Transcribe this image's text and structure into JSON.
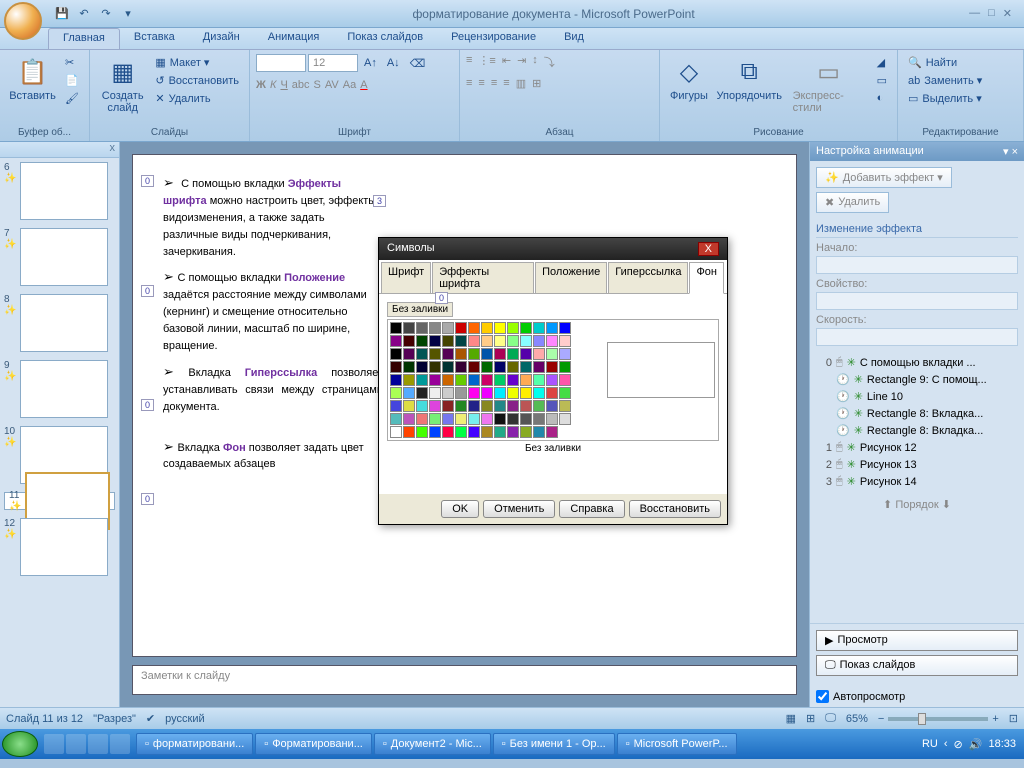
{
  "title": "форматирование документа - Microsoft PowerPoint",
  "qat": [
    "save",
    "undo",
    "redo"
  ],
  "tabs": [
    "Главная",
    "Вставка",
    "Дизайн",
    "Анимация",
    "Показ слайдов",
    "Рецензирование",
    "Вид"
  ],
  "ribbon": {
    "clipboard": {
      "label": "Буфер об...",
      "paste": "Вставить"
    },
    "slides": {
      "label": "Слайды",
      "new": "Создать\nслайд",
      "layout": "Макет ▾",
      "reset": "Восстановить",
      "delete": "Удалить"
    },
    "font": {
      "label": "Шрифт",
      "size": "12"
    },
    "para": {
      "label": "Абзац"
    },
    "draw": {
      "label": "Рисование",
      "shapes": "Фигуры",
      "arrange": "Упорядочить",
      "styles": "Экспресс-стили"
    },
    "edit": {
      "label": "Редактирование",
      "find": "Найти",
      "replace": "Заменить ▾",
      "select": "Выделить ▾"
    }
  },
  "thumbs": [
    6,
    7,
    8,
    9,
    10,
    11,
    12
  ],
  "active_thumb": 11,
  "slide": {
    "p1_pre": "С помощью вкладки ",
    "p1_b": "Эффекты шрифта",
    "p1_post": " можно настроить цвет, эффекты видоизменения, а также задать различные виды подчеркивания, зачеркивания.",
    "p2_pre": "С помощью вкладки ",
    "p2_b": "Положение",
    "p2_post": " задаётся расстояние между символами (кернинг) и смещение относительно базовой линии, масштаб по ширине, вращение.",
    "p3_pre": "Вкладка ",
    "p3_b": "Гиперссылка",
    "p3_post": " позволяет устанавливать связи между страницами документа.",
    "p4_pre": "Вкладка ",
    "p4_b": "Фон",
    "p4_post": " позволяет задать цвет создаваемых  абзацев",
    "tags": [
      "0",
      "0",
      "0",
      "0",
      "3",
      "0"
    ]
  },
  "notes": "Заметки к слайду",
  "dialog": {
    "title": "Символы",
    "tabs": [
      "Шрифт",
      "Эффекты шрифта",
      "Положение",
      "Гиперссылка",
      "Фон"
    ],
    "active_tab": 4,
    "nofill": "Без заливки",
    "nofill2": "Без заливки",
    "btns": {
      "ok": "OK",
      "cancel": "Отменить",
      "help": "Справка",
      "reset": "Восстановить"
    },
    "palette": [
      "#000",
      "#444",
      "#666",
      "#888",
      "#aaa",
      "#c00",
      "#f60",
      "#fc0",
      "#ff0",
      "#9f0",
      "#0c0",
      "#0cc",
      "#09f",
      "#00f",
      "#808",
      "#400",
      "#040",
      "#004",
      "#440",
      "#044",
      "#f88",
      "#fc8",
      "#ff8",
      "#8f8",
      "#8ff",
      "#88f",
      "#f8f",
      "#fcc",
      "#000",
      "#505",
      "#055",
      "#550",
      "#505",
      "#a50",
      "#5a0",
      "#05a",
      "#a05",
      "#0a5",
      "#50a",
      "#faa",
      "#afa",
      "#aaf",
      "#300",
      "#030",
      "#003",
      "#330",
      "#033",
      "#303",
      "#600",
      "#060",
      "#006",
      "#660",
      "#066",
      "#606",
      "#900",
      "#090",
      "#009",
      "#990",
      "#099",
      "#909",
      "#c60",
      "#6c0",
      "#06c",
      "#c06",
      "#0c6",
      "#60c",
      "#fa5",
      "#5fa",
      "#a5f",
      "#f5a",
      "#af5",
      "#5af",
      "#222",
      "#eee",
      "#ccc",
      "#999",
      "#f0e",
      "#e0f",
      "#0ef",
      "#ef0",
      "#fe0",
      "#0fe",
      "#d44",
      "#4d4",
      "#44d",
      "#dd4",
      "#4dd",
      "#d4d",
      "#822",
      "#282",
      "#228",
      "#882",
      "#288",
      "#828",
      "#b55",
      "#5b5",
      "#55b",
      "#bb5",
      "#5bb",
      "#b5b",
      "#e77",
      "#7e7",
      "#77e",
      "#ee7",
      "#7ee",
      "#e7e",
      "#111",
      "#333",
      "#555",
      "#777",
      "#bbb",
      "#ddd",
      "#fff",
      "#f40",
      "#4f0",
      "#04f",
      "#f04",
      "#0f4",
      "#40f",
      "#a82",
      "#2a8",
      "#82a",
      "#8a2",
      "#28a",
      "#a28"
    ]
  },
  "taskpane": {
    "title": "Настройка анимации",
    "add": "Добавить эффект ▾",
    "remove": "Удалить",
    "change": "Изменение эффекта",
    "start": "Начало:",
    "prop": "Свойство:",
    "speed": "Скорость:",
    "items": [
      {
        "n": "0",
        "txt": "С помощью вкладки ..."
      },
      {
        "n": "",
        "txt": "Rectangle 9:  С помощ..."
      },
      {
        "n": "",
        "txt": "Line 10"
      },
      {
        "n": "",
        "txt": "Rectangle 8:  Вкладка..."
      },
      {
        "n": "",
        "txt": "Rectangle 8:  Вкладка..."
      },
      {
        "n": "1",
        "txt": "Рисунок 12"
      },
      {
        "n": "2",
        "txt": "Рисунок 13"
      },
      {
        "n": "3",
        "txt": "Рисунок 14"
      }
    ],
    "reorder": "Порядок",
    "play": "Просмотр",
    "show": "Показ слайдов",
    "auto": "Автопросмотр"
  },
  "status": {
    "slide": "Слайд 11 из 12",
    "theme": "\"Разрез\"",
    "lang": "русский",
    "zoom": "65%"
  },
  "taskbar": {
    "items": [
      "форматировани...",
      "Форматировани...",
      "Документ2 - Mic...",
      "Без имени 1 - Op...",
      "Microsoft PowerP..."
    ],
    "lang": "RU",
    "time": "18:33"
  }
}
